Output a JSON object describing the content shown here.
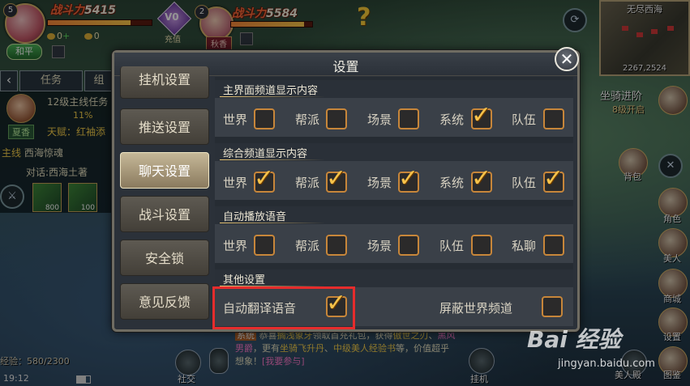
{
  "hud": {
    "player_level": "5",
    "power_label": "战斗力",
    "power_value": "5415",
    "peace_label": "和平",
    "vip_label": "V0",
    "vip_sub": "充值",
    "pet_level": "2",
    "pet_power_label": "战斗力",
    "pet_power_value": "5584",
    "pet_name": "秋香",
    "hp_fraction": 0.8
  },
  "minimap": {
    "title": "无尽西海",
    "coords": "2267,2524"
  },
  "mount": {
    "title": "坐骑进阶",
    "subtitle": "8级开启"
  },
  "left_panel": {
    "tabs": [
      "任务",
      "组"
    ],
    "quest_header": "12级主线任务",
    "progress": "11%",
    "npc_tag": "夏香",
    "talent": "天赋：红袖添",
    "mainline_label": "主线",
    "mainline_title": "西海惊魂",
    "dialogue": "对话:西海土著",
    "skill1_count": "800",
    "skill2_count": "100",
    "exp_label": "经验：580/2300",
    "time": "19:12"
  },
  "right_icons": {
    "bag": "背包",
    "role": "角色",
    "beauty": "美人",
    "shop": "商城",
    "settings": "设置",
    "map": "图鉴"
  },
  "bottom": {
    "social": "社交",
    "hangup": "挂机",
    "beauty_trial": "美人殿",
    "chat_sys_tag": "系统",
    "chat_line1_a": "恭喜",
    "chat_line1_b": "搁浅象牙",
    "chat_line1_c": "领取首充礼包，获得",
    "chat_line1_d": "傲世之刃",
    "chat_line2_a": "黑风男爵",
    "chat_line2_b": "，更有",
    "chat_line2_c": "坐骑飞升丹",
    "chat_line2_d": "、",
    "chat_line2_e": "中级美人经",
    "chat_line3_a": "验书",
    "chat_line3_b": "等，价值超乎想象！",
    "chat_line3_c": "[我要参与]"
  },
  "dialog": {
    "title": "设置",
    "nav": [
      {
        "label": "挂机设置",
        "active": false
      },
      {
        "label": "推送设置",
        "active": false
      },
      {
        "label": "聊天设置",
        "active": true
      },
      {
        "label": "战斗设置",
        "active": false
      },
      {
        "label": "安全锁",
        "active": false
      },
      {
        "label": "意见反馈",
        "active": false
      }
    ],
    "sections": [
      {
        "title": "主界面频道显示内容",
        "options": [
          {
            "label": "世界",
            "checked": false
          },
          {
            "label": "帮派",
            "checked": false
          },
          {
            "label": "场景",
            "checked": false
          },
          {
            "label": "系统",
            "checked": true
          },
          {
            "label": "队伍",
            "checked": false
          }
        ]
      },
      {
        "title": "综合频道显示内容",
        "options": [
          {
            "label": "世界",
            "checked": true
          },
          {
            "label": "帮派",
            "checked": true
          },
          {
            "label": "场景",
            "checked": true
          },
          {
            "label": "系统",
            "checked": true
          },
          {
            "label": "队伍",
            "checked": true
          }
        ]
      },
      {
        "title": "自动播放语音",
        "options": [
          {
            "label": "世界",
            "checked": false
          },
          {
            "label": "帮派",
            "checked": false
          },
          {
            "label": "场景",
            "checked": false
          },
          {
            "label": "队伍",
            "checked": false
          },
          {
            "label": "私聊",
            "checked": false
          }
        ]
      },
      {
        "title": "其他设置",
        "options": [
          {
            "label": "自动翻译语音",
            "checked": true
          },
          {
            "label": "屏蔽世界频道",
            "checked": false
          }
        ]
      }
    ]
  },
  "watermark": {
    "logo": "Bai 经验",
    "url": "jingyan.baidu.com"
  },
  "colors": {
    "accent_gold": "#f6c24a",
    "checkbox_border": "#c7863a",
    "highlight_red": "#e62c2c"
  }
}
